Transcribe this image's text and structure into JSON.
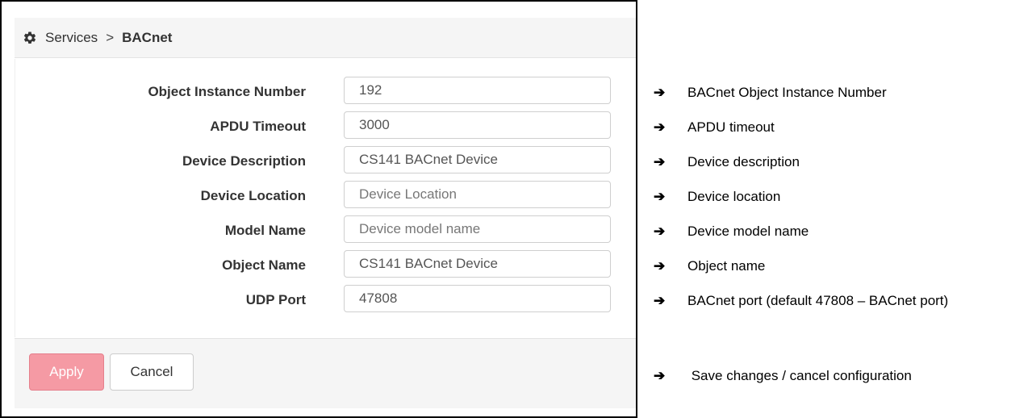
{
  "breadcrumb": {
    "icon": "gear-icon",
    "parent": "Services",
    "separator": ">",
    "current": "BACnet"
  },
  "form": {
    "fields": [
      {
        "label": "Object Instance Number",
        "value": "192",
        "placeholder": ""
      },
      {
        "label": "APDU Timeout",
        "value": "3000",
        "placeholder": ""
      },
      {
        "label": "Device Description",
        "value": "CS141 BACnet Device",
        "placeholder": ""
      },
      {
        "label": "Device Location",
        "value": "",
        "placeholder": "Device Location"
      },
      {
        "label": "Model Name",
        "value": "",
        "placeholder": "Device model name"
      },
      {
        "label": "Object Name",
        "value": "CS141 BACnet Device",
        "placeholder": ""
      },
      {
        "label": "UDP Port",
        "value": "47808",
        "placeholder": ""
      }
    ]
  },
  "footer": {
    "apply_label": "Apply",
    "cancel_label": "Cancel"
  },
  "annotations": {
    "arrow": "➔",
    "items": [
      "BACnet Object Instance Number",
      "APDU timeout",
      "Device description",
      "Device location",
      "Device model name",
      "Object name",
      "BACnet port (default 47808 – BACnet port)",
      " Save changes / cancel configuration"
    ]
  },
  "colors": {
    "apply_button": "#f59aa4",
    "header_bg": "#f5f5f5"
  }
}
